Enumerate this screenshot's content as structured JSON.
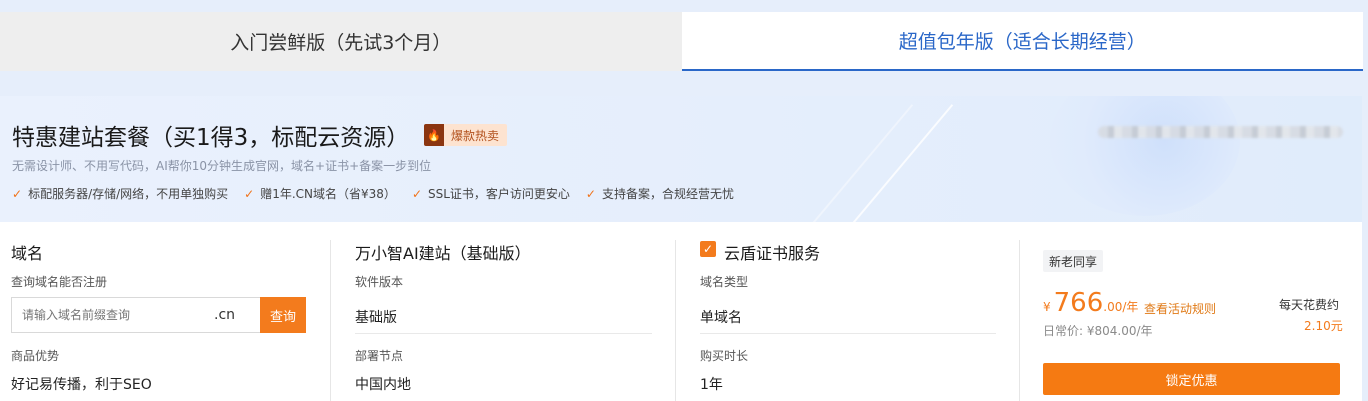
{
  "tabs": [
    {
      "label": "入门尝鲜版（先试3个月）"
    },
    {
      "label": "超值包年版（适合长期经营）"
    }
  ],
  "banner": {
    "title": "特惠建站套餐（买1得3，标配云资源）",
    "badge": "爆款热卖",
    "subtitle": "无需设计师、不用写代码，AI帮你10分钟生成官网，域名+证书+备案一步到位",
    "features": [
      "标配服务器/存储/网络，不用单独购买",
      "赠1年.CN域名（省¥38）",
      "SSL证书，客户访问更安心",
      "支持备案，合规经营无忧"
    ]
  },
  "domain": {
    "title": "域名",
    "query_label": "查询域名能否注册",
    "input_placeholder": "请输入域名前缀查询",
    "suffix": ".cn",
    "query_button": "查询",
    "advantage_label": "商品优势",
    "advantage_value": "好记易传播，利于SEO"
  },
  "ai_site": {
    "title": "万小智AI建站（基础版）",
    "version_label": "软件版本",
    "version_value": "基础版",
    "node_label": "部署节点",
    "node_value": "中国内地"
  },
  "cert": {
    "title": "云盾证书服务",
    "type_label": "域名类型",
    "type_value": "单域名",
    "duration_label": "购买时长",
    "duration_value": "1年"
  },
  "pricing": {
    "tag": "新老同享",
    "currency": "¥",
    "amount": "766",
    "decimal": ".00",
    "unit": "/年",
    "rule_link": "查看活动规则",
    "daily_label": "每天花费约",
    "daily_value": "2.10元",
    "original_price": "日常价: ¥804.00/年",
    "lock_button": "锁定优惠"
  },
  "colors": {
    "accent": "#f37b1d",
    "tab_active": "#2a67c8"
  }
}
